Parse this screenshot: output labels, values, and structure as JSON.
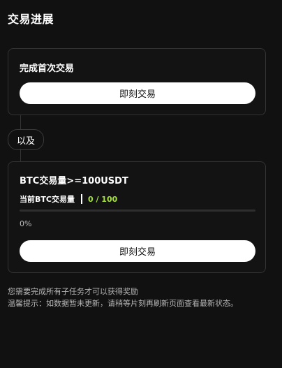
{
  "page": {
    "title": "交易进展"
  },
  "task1": {
    "title": "完成首次交易",
    "button_label": "即刻交易"
  },
  "connector_label": "以及",
  "task2": {
    "title": "BTC交易量>=100USDT",
    "progress_label": "当前BTC交易量",
    "progress_value": "0 / 100",
    "progress_fraction": 0,
    "progress_percent": "0%",
    "button_label": "即刻交易"
  },
  "notes": {
    "line1": "您需要完成所有子任务才可以获得奖励",
    "line2": "温馨提示：如数据暂未更新，请稍等片刻再刷新页面查看最新状态。"
  },
  "colors": {
    "background": "#111111",
    "accent": "#a6e33a",
    "button": "#ffffff"
  }
}
